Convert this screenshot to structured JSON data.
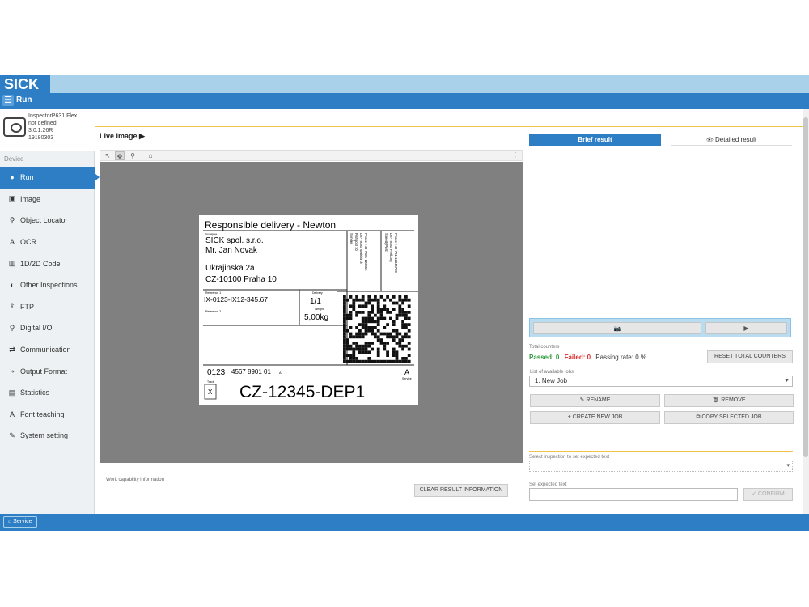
{
  "brand": {
    "logo": "SICK"
  },
  "runbar": {
    "menu_icon": "☰",
    "title": "Run"
  },
  "device": {
    "name": "InspectorP631 Flex",
    "location": "not defined",
    "version": "3.0.1.26R",
    "serial": "19180303",
    "section_label": "Device"
  },
  "nav": [
    {
      "icon": "●",
      "label": "Run"
    },
    {
      "icon": "▣",
      "label": "Image"
    },
    {
      "icon": "⚲",
      "label": "Object Locator"
    },
    {
      "icon": "A",
      "label": "OCR"
    },
    {
      "icon": "▥",
      "label": "1D/2D Code"
    },
    {
      "icon": "◐",
      "label": "Other Inspections"
    },
    {
      "icon": "⇪",
      "label": "FTP"
    },
    {
      "icon": "⚲",
      "label": "Digital I/O"
    },
    {
      "icon": "⇄",
      "label": "Communication"
    },
    {
      "icon": "⤷",
      "label": "Output Format"
    },
    {
      "icon": "▤",
      "label": "Statistics"
    },
    {
      "icon": "A",
      "label": "Font teaching"
    },
    {
      "icon": "✎",
      "label": "System setting"
    }
  ],
  "live": {
    "title": "Live image ▶",
    "tools": [
      "↖",
      "✥",
      "⚲",
      "⌂"
    ],
    "menu": "⋮"
  },
  "label": {
    "title": "Responsible delivery - Newton",
    "consignee_small": "Consignee",
    "company": "SICK spol. s.r.o.",
    "person": "Mr. Jan Novak",
    "street": "Ukrajinska 2a",
    "city": "CZ-10100 Praha 10",
    "sender_lines": [
      "Sender",
      "Fishgold 10",
      "DE-79183 Waldkirch",
      "Phone +49-7681-123456"
    ],
    "speed_lines": [
      "SpeedyPost",
      "DE-79183 Freiburg",
      "Phone +49-761-12345789"
    ],
    "reference_small": "Reference 1",
    "reference": "IX-0123-IX12-345.67",
    "reference2_small": "Reference 2",
    "delivery_small": "Delivery",
    "delivery": "1/1",
    "weight_small": "Weight",
    "weight": "5,00kg",
    "barcode_line_a": "0123",
    "barcode_line_b": "4567 8901 01",
    "barcode_suffix": "A",
    "service_letter": "A",
    "service_small": "Service",
    "track_small": "Track",
    "box_letter": "X",
    "tracking": "CZ-12345-DEP1"
  },
  "bottom_center": {
    "work_info": "Work capability information",
    "clear_button": "CLEAR RESULT INFORMATION"
  },
  "right": {
    "brief_tab": "Brief result",
    "detail_tab": "Detailed result",
    "eye_icon": "👁",
    "camera_icon": "📷",
    "play_icon": "▶",
    "total_counters_label": "Total counters",
    "passed": "Passed: 0",
    "failed": "Failed: 0",
    "rate": "Passing rate: 0 %",
    "reset_button": "RESET TOTAL COUNTERS",
    "jobs_label": "List of available jobs",
    "job_selected": "1. New Job",
    "rename": "✎ RENAME",
    "remove": "🗑 REMOVE",
    "create": "+ CREATE NEW JOB",
    "copy": "⧉ COPY SELECTED JOB",
    "select_inspection_label": "Select inspection to set expected text",
    "expected_label": "Set expected text",
    "confirm": "✓ CONFIRM"
  },
  "bottombar": {
    "service": "⌂ Service"
  },
  "colors": {
    "accent": "#2e7ec6",
    "brand_light": "#a9d1ea",
    "passed": "#2e9a3a",
    "failed": "#d92b2b",
    "line": "#f1c34a"
  }
}
